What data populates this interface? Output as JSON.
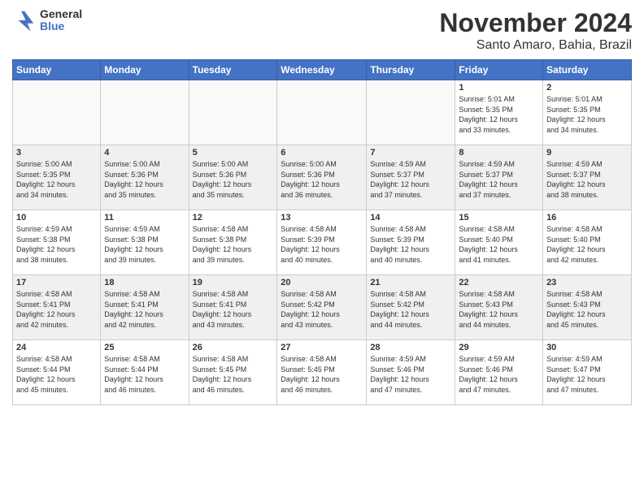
{
  "logo": {
    "general": "General",
    "blue": "Blue"
  },
  "title": "November 2024",
  "location": "Santo Amaro, Bahia, Brazil",
  "days_of_week": [
    "Sunday",
    "Monday",
    "Tuesday",
    "Wednesday",
    "Thursday",
    "Friday",
    "Saturday"
  ],
  "weeks": [
    [
      {
        "day": "",
        "info": ""
      },
      {
        "day": "",
        "info": ""
      },
      {
        "day": "",
        "info": ""
      },
      {
        "day": "",
        "info": ""
      },
      {
        "day": "",
        "info": ""
      },
      {
        "day": "1",
        "info": "Sunrise: 5:01 AM\nSunset: 5:35 PM\nDaylight: 12 hours\nand 33 minutes."
      },
      {
        "day": "2",
        "info": "Sunrise: 5:01 AM\nSunset: 5:35 PM\nDaylight: 12 hours\nand 34 minutes."
      }
    ],
    [
      {
        "day": "3",
        "info": "Sunrise: 5:00 AM\nSunset: 5:35 PM\nDaylight: 12 hours\nand 34 minutes."
      },
      {
        "day": "4",
        "info": "Sunrise: 5:00 AM\nSunset: 5:36 PM\nDaylight: 12 hours\nand 35 minutes."
      },
      {
        "day": "5",
        "info": "Sunrise: 5:00 AM\nSunset: 5:36 PM\nDaylight: 12 hours\nand 35 minutes."
      },
      {
        "day": "6",
        "info": "Sunrise: 5:00 AM\nSunset: 5:36 PM\nDaylight: 12 hours\nand 36 minutes."
      },
      {
        "day": "7",
        "info": "Sunrise: 4:59 AM\nSunset: 5:37 PM\nDaylight: 12 hours\nand 37 minutes."
      },
      {
        "day": "8",
        "info": "Sunrise: 4:59 AM\nSunset: 5:37 PM\nDaylight: 12 hours\nand 37 minutes."
      },
      {
        "day": "9",
        "info": "Sunrise: 4:59 AM\nSunset: 5:37 PM\nDaylight: 12 hours\nand 38 minutes."
      }
    ],
    [
      {
        "day": "10",
        "info": "Sunrise: 4:59 AM\nSunset: 5:38 PM\nDaylight: 12 hours\nand 38 minutes."
      },
      {
        "day": "11",
        "info": "Sunrise: 4:59 AM\nSunset: 5:38 PM\nDaylight: 12 hours\nand 39 minutes."
      },
      {
        "day": "12",
        "info": "Sunrise: 4:58 AM\nSunset: 5:38 PM\nDaylight: 12 hours\nand 39 minutes."
      },
      {
        "day": "13",
        "info": "Sunrise: 4:58 AM\nSunset: 5:39 PM\nDaylight: 12 hours\nand 40 minutes."
      },
      {
        "day": "14",
        "info": "Sunrise: 4:58 AM\nSunset: 5:39 PM\nDaylight: 12 hours\nand 40 minutes."
      },
      {
        "day": "15",
        "info": "Sunrise: 4:58 AM\nSunset: 5:40 PM\nDaylight: 12 hours\nand 41 minutes."
      },
      {
        "day": "16",
        "info": "Sunrise: 4:58 AM\nSunset: 5:40 PM\nDaylight: 12 hours\nand 42 minutes."
      }
    ],
    [
      {
        "day": "17",
        "info": "Sunrise: 4:58 AM\nSunset: 5:41 PM\nDaylight: 12 hours\nand 42 minutes."
      },
      {
        "day": "18",
        "info": "Sunrise: 4:58 AM\nSunset: 5:41 PM\nDaylight: 12 hours\nand 42 minutes."
      },
      {
        "day": "19",
        "info": "Sunrise: 4:58 AM\nSunset: 5:41 PM\nDaylight: 12 hours\nand 43 minutes."
      },
      {
        "day": "20",
        "info": "Sunrise: 4:58 AM\nSunset: 5:42 PM\nDaylight: 12 hours\nand 43 minutes."
      },
      {
        "day": "21",
        "info": "Sunrise: 4:58 AM\nSunset: 5:42 PM\nDaylight: 12 hours\nand 44 minutes."
      },
      {
        "day": "22",
        "info": "Sunrise: 4:58 AM\nSunset: 5:43 PM\nDaylight: 12 hours\nand 44 minutes."
      },
      {
        "day": "23",
        "info": "Sunrise: 4:58 AM\nSunset: 5:43 PM\nDaylight: 12 hours\nand 45 minutes."
      }
    ],
    [
      {
        "day": "24",
        "info": "Sunrise: 4:58 AM\nSunset: 5:44 PM\nDaylight: 12 hours\nand 45 minutes."
      },
      {
        "day": "25",
        "info": "Sunrise: 4:58 AM\nSunset: 5:44 PM\nDaylight: 12 hours\nand 46 minutes."
      },
      {
        "day": "26",
        "info": "Sunrise: 4:58 AM\nSunset: 5:45 PM\nDaylight: 12 hours\nand 46 minutes."
      },
      {
        "day": "27",
        "info": "Sunrise: 4:58 AM\nSunset: 5:45 PM\nDaylight: 12 hours\nand 46 minutes."
      },
      {
        "day": "28",
        "info": "Sunrise: 4:59 AM\nSunset: 5:46 PM\nDaylight: 12 hours\nand 47 minutes."
      },
      {
        "day": "29",
        "info": "Sunrise: 4:59 AM\nSunset: 5:46 PM\nDaylight: 12 hours\nand 47 minutes."
      },
      {
        "day": "30",
        "info": "Sunrise: 4:59 AM\nSunset: 5:47 PM\nDaylight: 12 hours\nand 47 minutes."
      }
    ]
  ]
}
